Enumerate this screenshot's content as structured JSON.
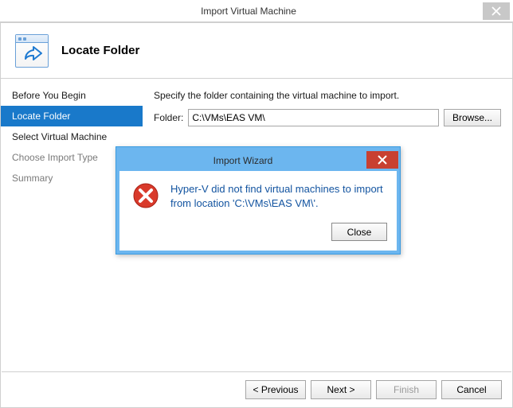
{
  "window": {
    "title": "Import Virtual Machine"
  },
  "header": {
    "title": "Locate Folder"
  },
  "sidebar": {
    "items": [
      {
        "label": "Before You Begin",
        "state": "normal"
      },
      {
        "label": "Locate Folder",
        "state": "selected"
      },
      {
        "label": "Select Virtual Machine",
        "state": "normal"
      },
      {
        "label": "Choose Import Type",
        "state": "dim"
      },
      {
        "label": "Summary",
        "state": "dim"
      }
    ]
  },
  "main": {
    "intro": "Specify the folder containing the virtual machine to import.",
    "folder_label": "Folder:",
    "folder_value": "C:\\VMs\\EAS VM\\",
    "browse_label": "Browse..."
  },
  "footer": {
    "previous": "< Previous",
    "next": "Next >",
    "finish": "Finish",
    "cancel": "Cancel"
  },
  "modal": {
    "title": "Import Wizard",
    "message": "Hyper-V did not find virtual machines to import from location 'C:\\VMs\\EAS VM\\'.",
    "close": "Close"
  }
}
